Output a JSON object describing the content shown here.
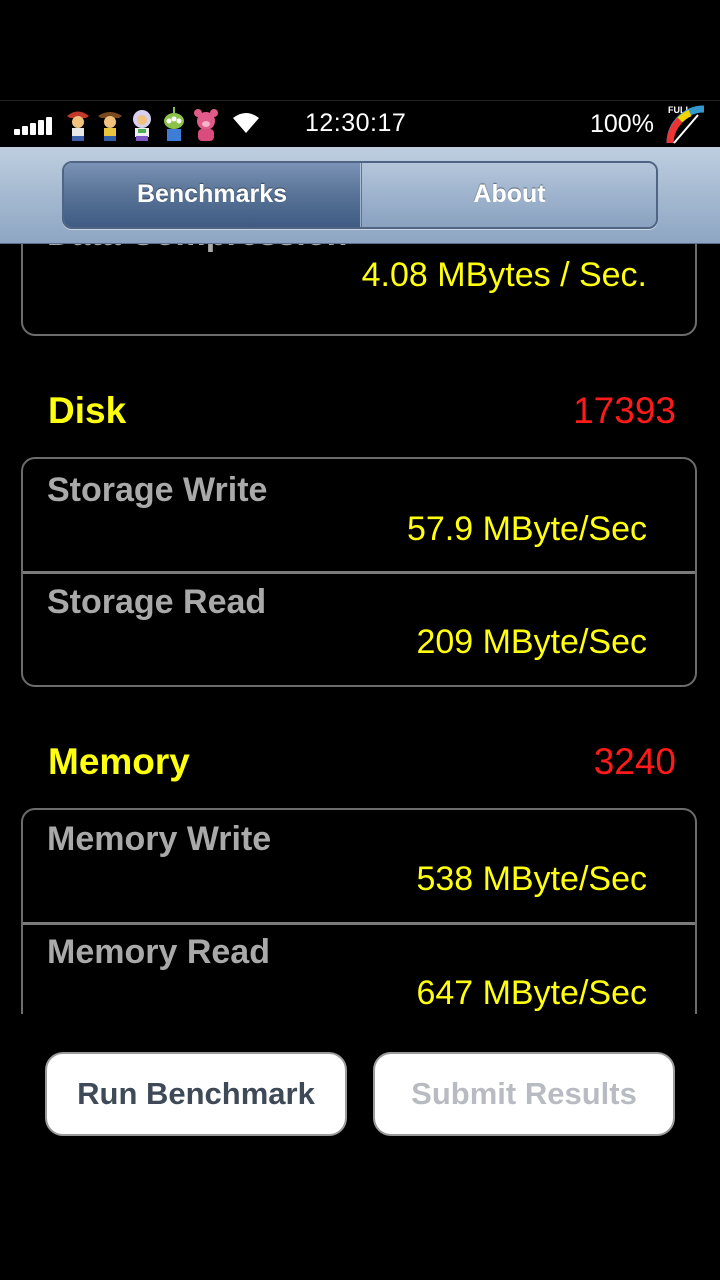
{
  "status_bar": {
    "time": "12:30:17",
    "battery": "100%",
    "gauge_label": "FULL",
    "icons": [
      "signal-bars-icon",
      "woody-icon",
      "jessie-icon",
      "buzz-icon",
      "alien-icon",
      "lotso-icon",
      "wifi-icon",
      "battery-gauge-icon"
    ]
  },
  "nav": {
    "tabs": [
      {
        "label": "Benchmarks",
        "selected": true
      },
      {
        "label": "About",
        "selected": false
      }
    ]
  },
  "sections": {
    "processor_tail": {
      "rows": [
        {
          "title": "Data Compression",
          "value": "4.08 MBytes / Sec."
        }
      ]
    },
    "disk": {
      "title": "Disk",
      "score": "17393",
      "rows": [
        {
          "title": "Storage Write",
          "value": "57.9 MByte/Sec"
        },
        {
          "title": "Storage Read",
          "value": "209 MByte/Sec"
        }
      ]
    },
    "memory": {
      "title": "Memory",
      "score": "3240",
      "rows": [
        {
          "title": "Memory Write",
          "value": "538 MByte/Sec"
        },
        {
          "title": "Memory Read",
          "value": "647 MByte/Sec"
        }
      ]
    }
  },
  "buttons": {
    "run": "Run Benchmark",
    "submit": "Submit Results"
  },
  "colors": {
    "section_title": "#ffff10",
    "score": "#ff1a1a",
    "value": "#ffff0f",
    "row_title": "#a9a9a9",
    "nav_selected": "#4f6b91"
  }
}
